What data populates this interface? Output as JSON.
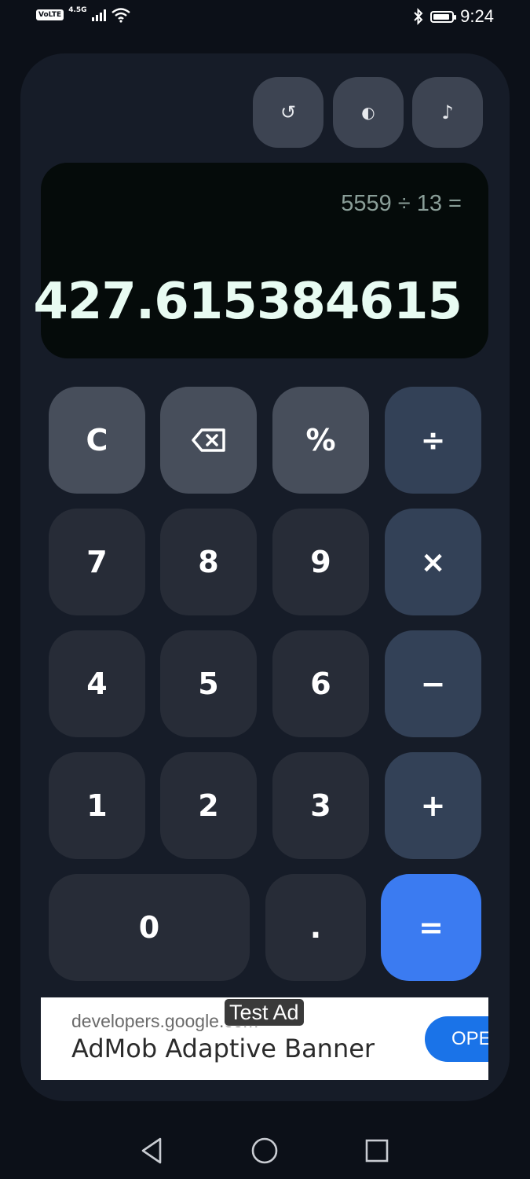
{
  "status_bar": {
    "volte": "VoLTE",
    "network": "4.5G",
    "time": "9:24",
    "icons": [
      "signal-icon",
      "wifi-icon",
      "bluetooth-icon",
      "battery-icon"
    ]
  },
  "top_buttons": [
    {
      "name": "history-button",
      "icon": "refresh-icon",
      "glyph": "↺"
    },
    {
      "name": "theme-toggle-button",
      "icon": "contrast-icon",
      "glyph": "◐"
    },
    {
      "name": "sound-toggle-button",
      "icon": "music-note-icon",
      "glyph": "♪"
    }
  ],
  "display": {
    "expression": "5559 ÷ 13 =",
    "result": "427.615384615"
  },
  "keypad": {
    "clear": "C",
    "backspace": "⌫",
    "percent": "%",
    "divide": "÷",
    "seven": "7",
    "eight": "8",
    "nine": "9",
    "multiply": "×",
    "four": "4",
    "five": "5",
    "six": "6",
    "minus": "−",
    "one": "1",
    "two": "2",
    "three": "3",
    "plus": "+",
    "zero": "0",
    "decimal": ".",
    "equals": "="
  },
  "ad": {
    "url": "developers.google.com",
    "title": "AdMob Adaptive Banner",
    "tag": "Test Ad",
    "cta": "OPEN"
  },
  "colors": {
    "background": "#0c1018",
    "card": "#161c28",
    "function_key": "#474e5b",
    "number_key": "#272c37",
    "operator_key": "#334157",
    "equals_key": "#3b7bf1",
    "display_bg": "#050b0a"
  },
  "nav_bar": [
    "back-icon",
    "home-icon",
    "recents-icon"
  ]
}
